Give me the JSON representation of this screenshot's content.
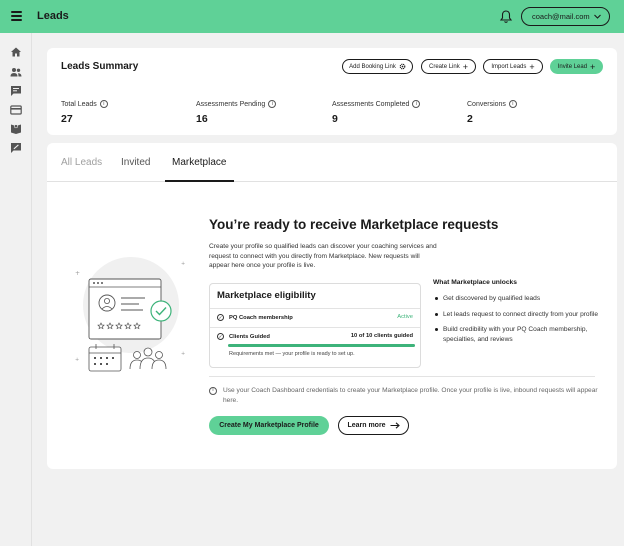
{
  "app": {
    "title": "Leads"
  },
  "header": {
    "account_email": "coach@mail.com"
  },
  "sidebar": {
    "icons": [
      "home-icon",
      "people-icon",
      "chat-icon",
      "card-icon",
      "book-icon",
      "feedback-icon"
    ]
  },
  "summary": {
    "title": "Leads Summary",
    "buttons": {
      "add_booking_link": "Add Booking Link",
      "create_link": "Create Link",
      "import_leads": "Import Leads",
      "invite_lead": "Invite Lead"
    },
    "stats": [
      {
        "label": "Total Leads",
        "value": "27"
      },
      {
        "label": "Assessments Pending",
        "value": "16"
      },
      {
        "label": "Assessments Completed",
        "value": "9"
      },
      {
        "label": "Conversions",
        "value": "2"
      }
    ]
  },
  "tabs": {
    "all_leads": "All Leads",
    "invited": "Invited",
    "marketplace": "Marketplace"
  },
  "marketplace": {
    "heading": "You’re ready to receive Marketplace requests",
    "intro": "Create your profile so qualified leads can discover your coaching services and request to connect with you directly from Marketplace. New requests will appear here once your profile is live.",
    "eligibility": {
      "title": "Marketplace eligibility",
      "req1_label": "PQ Coach membership",
      "req1_status": "Active",
      "req2_label": "Clients Guided",
      "req2_count": "10 of 10 clients guided",
      "req2_progress": 1.0,
      "met_text": "Requirements met — your profile is ready to set up."
    },
    "unlocks": {
      "title": "What Marketplace unlocks",
      "items": [
        "Get discovered by qualified leads",
        "Let leads request to connect directly from your profile",
        "Build credibility with your PQ Coach membership, specialties, and reviews"
      ]
    },
    "note": "Use your Coach Dashboard credentials to create your Marketplace profile. Once your profile is live, inbound requests will appear here.",
    "create_button": "Create My Marketplace Profile",
    "learn_button": "Learn more"
  },
  "colors": {
    "brand_green": "#5fd197",
    "success_green": "#3db37a"
  }
}
